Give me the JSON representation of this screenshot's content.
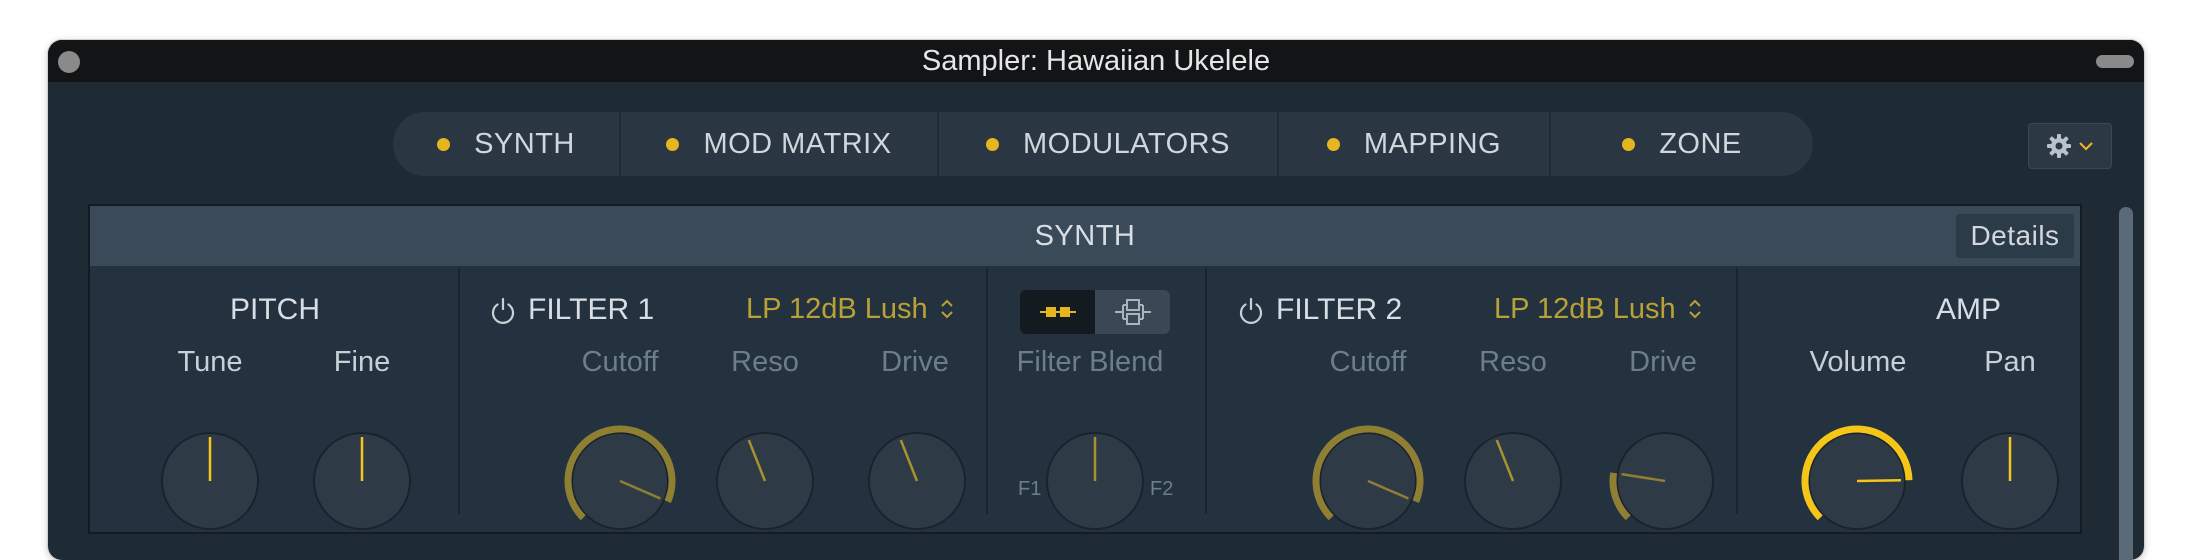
{
  "window": {
    "title": "Sampler: Hawaiian Ukelele"
  },
  "tabs": [
    {
      "label": "SYNTH"
    },
    {
      "label": "MOD MATRIX"
    },
    {
      "label": "MODULATORS"
    },
    {
      "label": "MAPPING"
    },
    {
      "label": "ZONE"
    }
  ],
  "synth": {
    "header": "SYNTH",
    "details_label": "Details",
    "pitch": {
      "title": "PITCH",
      "tune_label": "Tune",
      "fine_label": "Fine",
      "tune_value": 0.5,
      "fine_value": 0.5
    },
    "filter1": {
      "title": "FILTER 1",
      "type": "LP 12dB Lush",
      "cutoff_label": "Cutoff",
      "reso_label": "Reso",
      "drive_label": "Drive",
      "cutoff_value": 0.92,
      "reso_value": 0.42,
      "drive_value": 0.42
    },
    "blend": {
      "label": "Filter Blend",
      "f1_label": "F1",
      "f2_label": "F2",
      "value": 0.5
    },
    "filter2": {
      "title": "FILTER 2",
      "type": "LP 12dB Lush",
      "cutoff_label": "Cutoff",
      "reso_label": "Reso",
      "drive_label": "Drive",
      "cutoff_value": 0.92,
      "reso_value": 0.42,
      "drive_value": 0.2
    },
    "amp": {
      "title": "AMP",
      "volume_label": "Volume",
      "pan_label": "Pan",
      "volume_value": 0.83,
      "pan_value": 0.5
    }
  },
  "colors": {
    "accent": "#e6b620",
    "dim_gold": "#8f7f33",
    "bright_gold": "#f5c518",
    "knob_indicator_dim": "#a8922f",
    "panel": "#243240",
    "header": "#3a4a58"
  },
  "icons": {
    "tab_dot": "dot-indicator-icon",
    "gear": "gear-icon",
    "chevron": "chevron-down-icon",
    "power": "power-icon",
    "updown": "updown-chevron-icon",
    "serial": "serial-routing-icon",
    "parallel": "parallel-routing-icon"
  }
}
